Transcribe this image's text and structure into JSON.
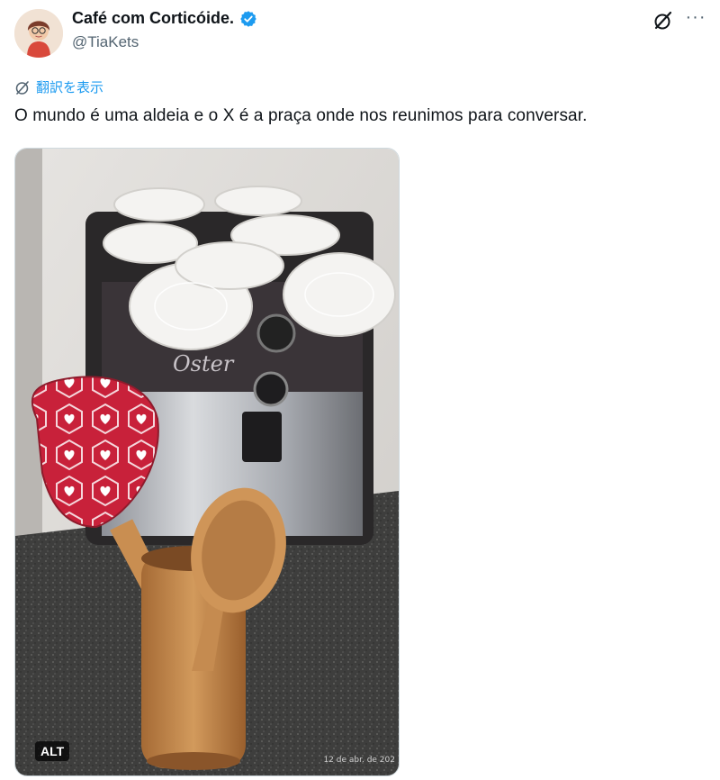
{
  "author": {
    "display_name": "Café com Corticóide.",
    "handle": "@TiaKets",
    "verified": true
  },
  "header_actions": {
    "grok_icon": "grok-slash-icon",
    "more_icon": "ellipsis-icon",
    "more_label": "···"
  },
  "translate": {
    "label": "翻訳を表示",
    "icon": "translate-globe-icon"
  },
  "tweet": {
    "text": "O mundo é uma aldeia e o X é a praça onde nos reunimos para conversar."
  },
  "media": {
    "alt_badge": "ALT",
    "photo_timestamp": "12 de abr. de 202",
    "brand_on_appliance": "Oster"
  },
  "colors": {
    "accent": "#1d9bf0",
    "text_primary": "#0f1419",
    "text_secondary": "#536471",
    "spatula_red": "#c8213a",
    "countertop": "#3b3b3a"
  }
}
